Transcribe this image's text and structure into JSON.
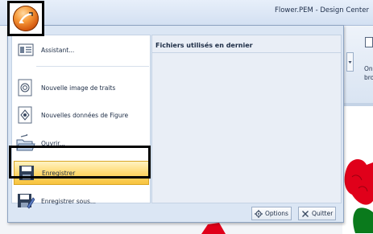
{
  "window": {
    "title": "Flower.PEM - Design Center"
  },
  "ribbon": {
    "partial_label": "On\nbro"
  },
  "app_menu": {
    "items": [
      {
        "label": "Assistant...",
        "icon": "assistant-icon"
      },
      {
        "label": "Nouvelle image de traits",
        "icon": "new-line-image-icon"
      },
      {
        "label": "Nouvelles données de Figure",
        "icon": "new-figure-data-icon"
      },
      {
        "label": "Ouvrir...",
        "icon": "open-folder-icon"
      },
      {
        "label": "Enregistrer",
        "icon": "save-icon",
        "highlighted": true
      },
      {
        "label": "Enregistrer sous...",
        "icon": "save-as-icon"
      }
    ],
    "recent_files_header": "Fichiers utilisés en dernier",
    "options_label": "Options",
    "quit_label": "Quitter"
  },
  "colors": {
    "highlight": "#f7c33e",
    "menu_bg": "#dbe6f4",
    "flower_red": "#e0001a",
    "flower_green": "#0a7a1c"
  }
}
